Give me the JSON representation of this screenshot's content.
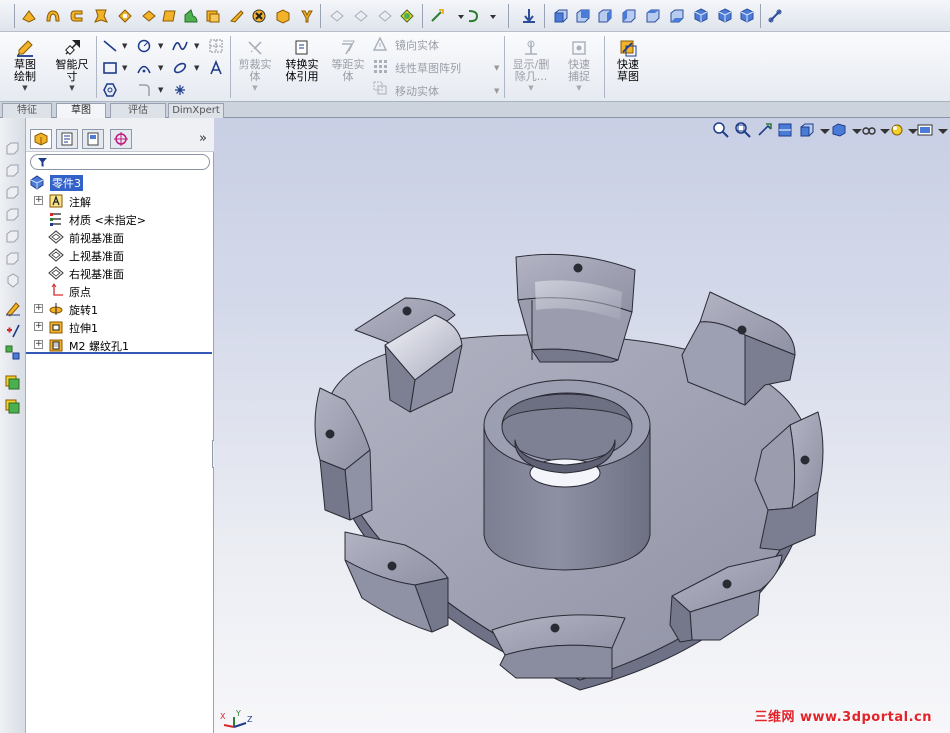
{
  "commands": {
    "sketch": "草图绘制",
    "smart_dim": "智能尺寸",
    "trim": "剪裁实体",
    "convert": "转换实体引用",
    "offset": "等距实体",
    "mirror": "镜向实体",
    "linear_pattern": "线性草图阵列",
    "move": "移动实体",
    "display_delete": "显示/删除几...",
    "quick_snap": "快速捕捉",
    "rapid_sketch": "快速草图"
  },
  "tabs": [
    "特征",
    "草图",
    "评估",
    "DimXpert"
  ],
  "active_tab": 1,
  "feature_tree": {
    "root": "零件3",
    "items": [
      {
        "label": "注解",
        "icon": "annotation-icon",
        "expandable": true
      },
      {
        "label": "材质 <未指定>",
        "icon": "material-icon",
        "expandable": false
      },
      {
        "label": "前视基准面",
        "icon": "plane-icon",
        "expandable": false
      },
      {
        "label": "上视基准面",
        "icon": "plane-icon",
        "expandable": false
      },
      {
        "label": "右视基准面",
        "icon": "plane-icon",
        "expandable": false
      },
      {
        "label": "原点",
        "icon": "origin-icon",
        "expandable": false
      },
      {
        "label": "旋转1",
        "icon": "revolve-icon",
        "expandable": true
      },
      {
        "label": "拉伸1",
        "icon": "extrude-icon",
        "expandable": true
      },
      {
        "label": "M2 螺纹孔1",
        "icon": "hole-icon",
        "expandable": true
      }
    ],
    "more_tabs_glyph": "»"
  },
  "viewport": {
    "watermark": "三维网 www.3dportal.cn",
    "triad_x": "X",
    "triad_y": "Y",
    "triad_z": "Z"
  },
  "colors": {
    "selection": "#3261c9",
    "model_face": "#9a9caf",
    "model_edge": "#2b2b35",
    "watermark": "#e2232a"
  }
}
